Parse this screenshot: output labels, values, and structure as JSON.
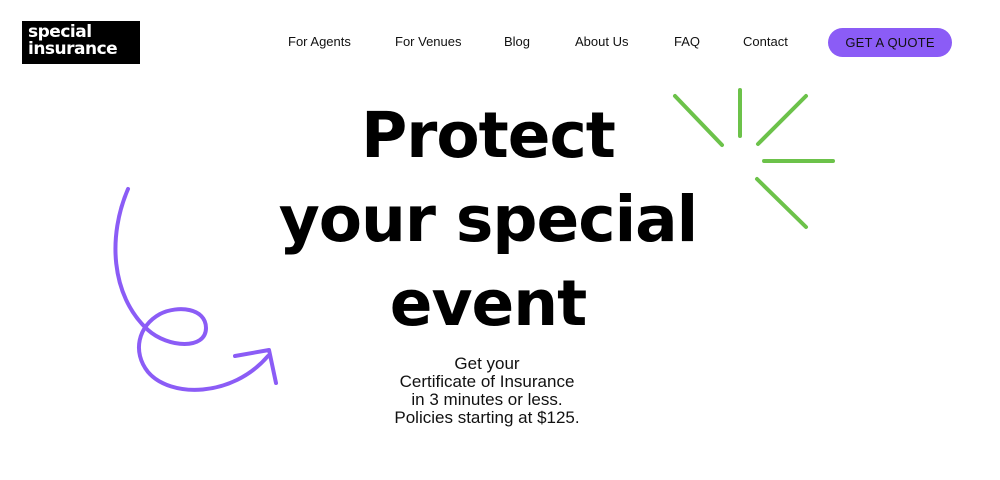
{
  "logo": {
    "line1": "special",
    "line2": "insurance"
  },
  "nav": {
    "items": [
      {
        "label": "For Agents"
      },
      {
        "label": "For Venues"
      },
      {
        "label": "Blog"
      },
      {
        "label": "About Us"
      },
      {
        "label": "FAQ"
      },
      {
        "label": "Contact"
      }
    ],
    "cta_label": "GET A QUOTE"
  },
  "hero": {
    "title_lines": [
      "Protect",
      "your special",
      "event"
    ],
    "subtitle_lines": [
      "Get your",
      "Certificate of Insurance",
      "in 3 minutes or less.",
      "Policies starting at $125."
    ]
  },
  "colors": {
    "accent_purple": "#8b5cf6",
    "accent_green": "#6cc24a"
  },
  "icons": {
    "sparkle": "sparkle-burst-icon",
    "swirl": "swirl-arrow-icon"
  }
}
